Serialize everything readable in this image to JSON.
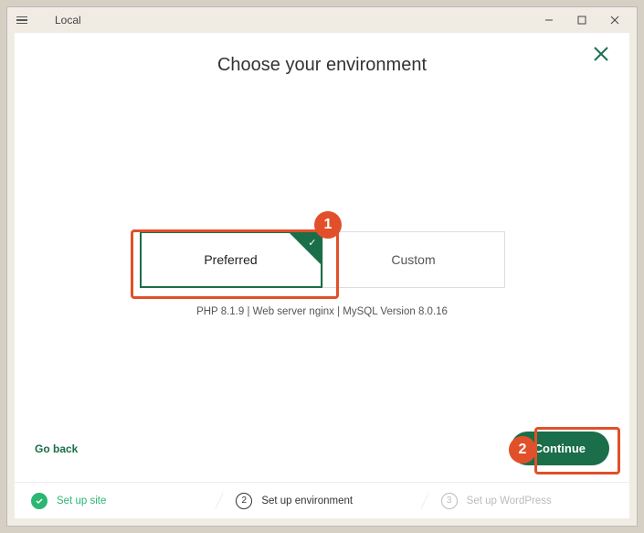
{
  "window": {
    "title": "Local"
  },
  "header": {
    "title": "Choose your environment"
  },
  "options": {
    "preferred": {
      "label": "Preferred",
      "selected": true
    },
    "custom": {
      "label": "Custom",
      "selected": false
    }
  },
  "info_line": "PHP 8.1.9 | Web server nginx | MySQL Version 8.0.16",
  "footer": {
    "go_back": "Go back",
    "continue": "Continue"
  },
  "steps": [
    {
      "num": "✓",
      "label": "Set up site",
      "state": "done"
    },
    {
      "num": "2",
      "label": "Set up environment",
      "state": "current"
    },
    {
      "num": "3",
      "label": "Set up WordPress",
      "state": "upcoming"
    }
  ],
  "callouts": {
    "c1": "1",
    "c2": "2"
  },
  "colors": {
    "accent": "#1a6e4a",
    "callout": "#e1502a",
    "success": "#2bb673"
  }
}
